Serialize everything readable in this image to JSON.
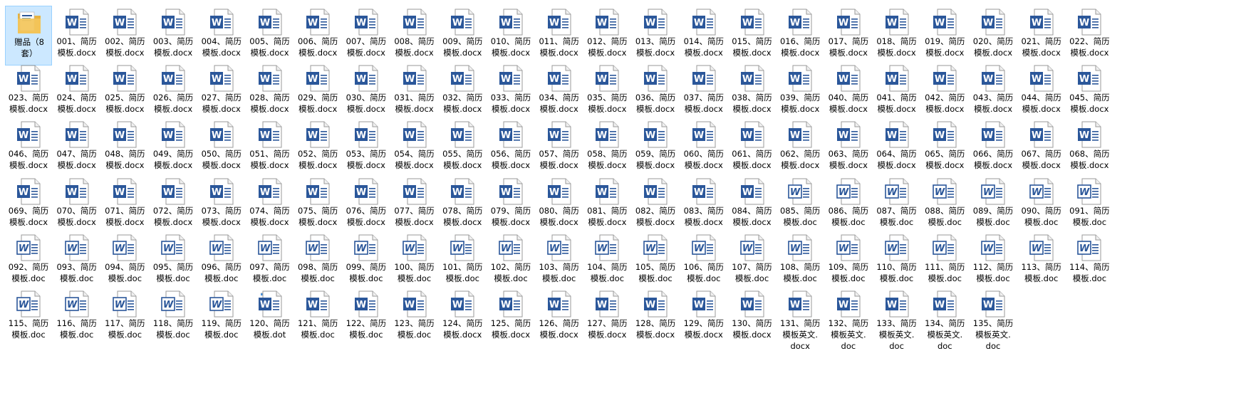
{
  "window": {
    "view": "large-icons"
  },
  "icons": {
    "word-docx": "word-document-icon",
    "word-doc": "word-97-2003-document-icon",
    "word-dot": "word-template-icon",
    "folder": "folder-icon"
  },
  "colors": {
    "word_blue": "#2b579a",
    "select_bg": "#cce8ff",
    "select_border": "#99d1ff",
    "folder": "#f3c65a"
  },
  "files": [
    {
      "name": "赠品（8\n套）",
      "type": "folder",
      "selected": true
    },
    {
      "name": "001、简历\n模板.docx",
      "type": "docx"
    },
    {
      "name": "002、简历\n模板.docx",
      "type": "docx"
    },
    {
      "name": "003、简历\n模板.docx",
      "type": "docx"
    },
    {
      "name": "004、简历\n模板.docx",
      "type": "docx"
    },
    {
      "name": "005、简历\n模板.docx",
      "type": "docx"
    },
    {
      "name": "006、简历\n模板.docx",
      "type": "docx"
    },
    {
      "name": "007、简历\n模板.docx",
      "type": "docx"
    },
    {
      "name": "008、简历\n模板.docx",
      "type": "docx"
    },
    {
      "name": "009、简历\n模板.docx",
      "type": "docx"
    },
    {
      "name": "010、简历\n模板.docx",
      "type": "docx"
    },
    {
      "name": "011、简历\n模板.docx",
      "type": "docx"
    },
    {
      "name": "012、简历\n模板.docx",
      "type": "docx"
    },
    {
      "name": "013、简历\n模板.docx",
      "type": "docx"
    },
    {
      "name": "014、简历\n模板.docx",
      "type": "docx"
    },
    {
      "name": "015、简历\n模板.docx",
      "type": "docx"
    },
    {
      "name": "016、简历\n模板.docx",
      "type": "docx"
    },
    {
      "name": "017、简历\n模板.docx",
      "type": "docx"
    },
    {
      "name": "018、简历\n模板.docx",
      "type": "docx"
    },
    {
      "name": "019、简历\n模板.docx",
      "type": "docx"
    },
    {
      "name": "020、简历\n模板.docx",
      "type": "docx"
    },
    {
      "name": "021、简历\n模板.docx",
      "type": "docx"
    },
    {
      "name": "022、简历\n模板.docx",
      "type": "docx"
    },
    {
      "name": "023、简历\n模板.docx",
      "type": "docx"
    },
    {
      "name": "024、简历\n模板.docx",
      "type": "docx"
    },
    {
      "name": "025、简历\n模板.docx",
      "type": "docx"
    },
    {
      "name": "026、简历\n模板.docx",
      "type": "docx"
    },
    {
      "name": "027、简历\n模板.docx",
      "type": "docx"
    },
    {
      "name": "028、简历\n模板.docx",
      "type": "docx"
    },
    {
      "name": "029、简历\n模板.docx",
      "type": "docx"
    },
    {
      "name": "030、简历\n模板.docx",
      "type": "docx"
    },
    {
      "name": "031、简历\n模板.docx",
      "type": "docx"
    },
    {
      "name": "032、简历\n模板.docx",
      "type": "docx"
    },
    {
      "name": "033、简历\n模板.docx",
      "type": "docx"
    },
    {
      "name": "034、简历\n模板.docx",
      "type": "docx"
    },
    {
      "name": "035、简历\n模板.docx",
      "type": "docx"
    },
    {
      "name": "036、简历\n模板.docx",
      "type": "docx"
    },
    {
      "name": "037、简历\n模板.docx",
      "type": "docx"
    },
    {
      "name": "038、简历\n模板.docx",
      "type": "docx"
    },
    {
      "name": "039、简历\n模板.docx",
      "type": "docx"
    },
    {
      "name": "040、简历\n模板.docx",
      "type": "docx"
    },
    {
      "name": "041、简历\n模板.docx",
      "type": "docx"
    },
    {
      "name": "042、简历\n模板.docx",
      "type": "docx"
    },
    {
      "name": "043、简历\n模板.docx",
      "type": "docx"
    },
    {
      "name": "044、简历\n模板.docx",
      "type": "docx"
    },
    {
      "name": "045、简历\n模板.docx",
      "type": "docx"
    },
    {
      "name": "046、简历\n模板.docx",
      "type": "docx"
    },
    {
      "name": "047、简历\n模板.docx",
      "type": "docx"
    },
    {
      "name": "048、简历\n模板.docx",
      "type": "docx"
    },
    {
      "name": "049、简历\n模板.docx",
      "type": "docx"
    },
    {
      "name": "050、简历\n模板.docx",
      "type": "docx"
    },
    {
      "name": "051、简历\n模板.docx",
      "type": "docx"
    },
    {
      "name": "052、简历\n模板.docx",
      "type": "docx"
    },
    {
      "name": "053、简历\n模板.docx",
      "type": "docx"
    },
    {
      "name": "054、简历\n模板.docx",
      "type": "docx"
    },
    {
      "name": "055、简历\n模板.docx",
      "type": "docx"
    },
    {
      "name": "056、简历\n模板.docx",
      "type": "docx"
    },
    {
      "name": "057、简历\n模板.docx",
      "type": "docx"
    },
    {
      "name": "058、简历\n模板.docx",
      "type": "docx"
    },
    {
      "name": "059、简历\n模板.docx",
      "type": "docx"
    },
    {
      "name": "060、简历\n模板.docx",
      "type": "docx"
    },
    {
      "name": "061、简历\n模板.docx",
      "type": "docx"
    },
    {
      "name": "062、简历\n模板.docx",
      "type": "docx"
    },
    {
      "name": "063、简历\n模板.docx",
      "type": "docx"
    },
    {
      "name": "064、简历\n模板.docx",
      "type": "docx"
    },
    {
      "name": "065、简历\n模板.docx",
      "type": "docx"
    },
    {
      "name": "066、简历\n模板.docx",
      "type": "docx"
    },
    {
      "name": "067、简历\n模板.docx",
      "type": "docx"
    },
    {
      "name": "068、简历\n模板.docx",
      "type": "docx"
    },
    {
      "name": "069、简历\n模板.docx",
      "type": "docx"
    },
    {
      "name": "070、简历\n模板.docx",
      "type": "docx"
    },
    {
      "name": "071、简历\n模板.docx",
      "type": "docx"
    },
    {
      "name": "072、简历\n模板.docx",
      "type": "docx"
    },
    {
      "name": "073、简历\n模板.docx",
      "type": "docx"
    },
    {
      "name": "074、简历\n模板.docx",
      "type": "docx"
    },
    {
      "name": "075、简历\n模板.docx",
      "type": "docx"
    },
    {
      "name": "076、简历\n模板.docx",
      "type": "docx"
    },
    {
      "name": "077、简历\n模板.docx",
      "type": "docx"
    },
    {
      "name": "078、简历\n模板.docx",
      "type": "docx"
    },
    {
      "name": "079、简历\n模板.docx",
      "type": "docx"
    },
    {
      "name": "080、简历\n模板.docx",
      "type": "docx"
    },
    {
      "name": "081、简历\n模板.docx",
      "type": "docx"
    },
    {
      "name": "082、简历\n模板.docx",
      "type": "docx"
    },
    {
      "name": "083、简历\n模板.docx",
      "type": "docx"
    },
    {
      "name": "084、简历\n模板.docx",
      "type": "docx"
    },
    {
      "name": "085、简历\n模板.doc",
      "type": "doc"
    },
    {
      "name": "086、简历\n模板.doc",
      "type": "doc"
    },
    {
      "name": "087、简历\n模板.doc",
      "type": "doc"
    },
    {
      "name": "088、简历\n模板.doc",
      "type": "doc"
    },
    {
      "name": "089、简历\n模板.doc",
      "type": "doc"
    },
    {
      "name": "090、简历\n模板.doc",
      "type": "doc"
    },
    {
      "name": "091、简历\n模板.doc",
      "type": "doc"
    },
    {
      "name": "092、简历\n模板.doc",
      "type": "doc"
    },
    {
      "name": "093、简历\n模板.doc",
      "type": "doc"
    },
    {
      "name": "094、简历\n模板.doc",
      "type": "doc"
    },
    {
      "name": "095、简历\n模板.doc",
      "type": "doc"
    },
    {
      "name": "096、简历\n模板.doc",
      "type": "doc"
    },
    {
      "name": "097、简历\n模板.doc",
      "type": "doc"
    },
    {
      "name": "098、简历\n模板.doc",
      "type": "doc"
    },
    {
      "name": "099、简历\n模板.doc",
      "type": "doc"
    },
    {
      "name": "100、简历\n模板.doc",
      "type": "doc"
    },
    {
      "name": "101、简历\n模板.doc",
      "type": "doc"
    },
    {
      "name": "102、简历\n模板.doc",
      "type": "doc"
    },
    {
      "name": "103、简历\n模板.doc",
      "type": "doc"
    },
    {
      "name": "104、简历\n模板.doc",
      "type": "doc"
    },
    {
      "name": "105、简历\n模板.doc",
      "type": "doc"
    },
    {
      "name": "106、简历\n模板.doc",
      "type": "doc"
    },
    {
      "name": "107、简历\n模板.doc",
      "type": "doc"
    },
    {
      "name": "108、简历\n模板.doc",
      "type": "doc"
    },
    {
      "name": "109、简历\n模板.doc",
      "type": "doc"
    },
    {
      "name": "110、简历\n模板.doc",
      "type": "doc"
    },
    {
      "name": "111、简历\n模板.doc",
      "type": "doc"
    },
    {
      "name": "112、简历\n模板.doc",
      "type": "doc"
    },
    {
      "name": "113、简历\n模板.doc",
      "type": "doc"
    },
    {
      "name": "114、简历\n模板.doc",
      "type": "doc"
    },
    {
      "name": "115、简历\n模板.doc",
      "type": "doc"
    },
    {
      "name": "116、简历\n模板.doc",
      "type": "doc"
    },
    {
      "name": "117、简历\n模板.doc",
      "type": "doc"
    },
    {
      "name": "118、简历\n模板.doc",
      "type": "doc"
    },
    {
      "name": "119、简历\n模板.doc",
      "type": "doc"
    },
    {
      "name": "120、简历\n模板.dot",
      "type": "dot"
    },
    {
      "name": "121、简历\n模板.doc",
      "type": "docx"
    },
    {
      "name": "122、简历\n模板.doc",
      "type": "docx"
    },
    {
      "name": "123、简历\n模板.doc",
      "type": "docx"
    },
    {
      "name": "124、简历\n模板.docx",
      "type": "docx"
    },
    {
      "name": "125、简历\n模板.docx",
      "type": "docx"
    },
    {
      "name": "126、简历\n模板.docx",
      "type": "docx"
    },
    {
      "name": "127、简历\n模板.docx",
      "type": "docx"
    },
    {
      "name": "128、简历\n模板.docx",
      "type": "docx"
    },
    {
      "name": "129、简历\n模板.docx",
      "type": "docx"
    },
    {
      "name": "130、简历\n模板.docx",
      "type": "docx"
    },
    {
      "name": "131、简历\n模板英文.\ndocx",
      "type": "docx"
    },
    {
      "name": "132、简历\n模板英文.\ndoc",
      "type": "docx"
    },
    {
      "name": "133、简历\n模板英文.\ndoc",
      "type": "docx"
    },
    {
      "name": "134、简历\n模板英文.\ndoc",
      "type": "docx"
    },
    {
      "name": "135、简历\n模板英文.\ndoc",
      "type": "docx"
    }
  ]
}
